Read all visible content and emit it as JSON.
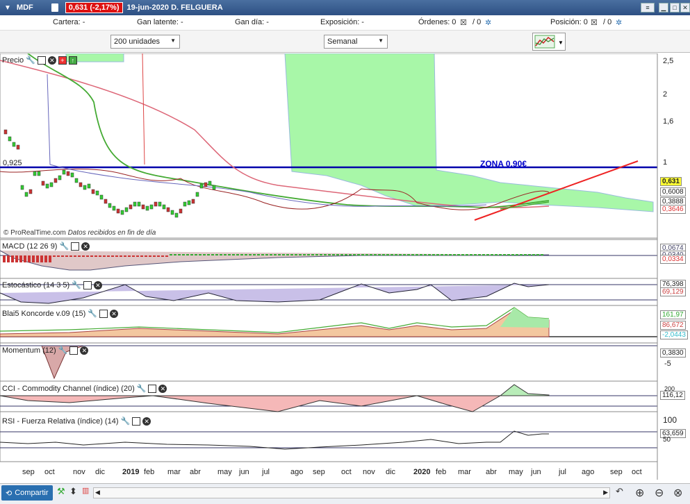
{
  "titlebar": {
    "symbol": "MDF",
    "price_change": "0,631 (-2,17%)",
    "date_name": "19-jun-2020 D. FELGUERA"
  },
  "info": {
    "cartera": "Cartera: -",
    "gan_latente": "Gan latente: -",
    "gan_dia": "Gan día: -",
    "exposicion": "Exposición: -",
    "ordenes": "Órdenes: 0",
    "ordenes_2": "/ 0",
    "posicion": "Posición: 0",
    "posicion_2": "/ 0"
  },
  "controls": {
    "units": "200 unidades",
    "period": "Semanal"
  },
  "panels": {
    "price": {
      "title": "Precio",
      "hline_label": "0,925",
      "zone_label": "ZONA 0,90€",
      "axis": [
        "2,5",
        "2",
        "1,6",
        "1"
      ],
      "tags": [
        {
          "text": "0,631",
          "bg": "#ffff33",
          "color": "#000"
        },
        {
          "text": "0,6008",
          "bg": "#ffffff",
          "color": "#555"
        },
        {
          "text": "0,3888",
          "bg": "#ffffff",
          "color": "#555"
        },
        {
          "text": "0,3646",
          "bg": "#ffffff",
          "color": "#d33"
        }
      ],
      "footer": "© ProRealTime.com",
      "footer_note": "Datos recibidos en fin de día"
    },
    "macd": {
      "title": "MACD (12 26 9)",
      "tags": [
        "0,0674",
        "0,0340",
        "0,0334"
      ]
    },
    "stoch": {
      "title": "Estocástico (14 3 5)",
      "tags": [
        "76,398",
        "69,129"
      ]
    },
    "koncorde": {
      "title": "Blai5 Koncorde v.09 (15)",
      "tags": [
        "161,97",
        "86,672",
        "-2,0443"
      ]
    },
    "momentum": {
      "title": "Momentum (12)",
      "axis": "-5",
      "tags": [
        "0,3830"
      ]
    },
    "cci": {
      "title": "CCI - Commodity Channel (índice) (20)",
      "axis": "200",
      "tags": [
        "116,12"
      ]
    },
    "rsi": {
      "title": "RSI - Fuerza Relativa (índice) (14)",
      "axis_top": "100",
      "axis_mid": "50",
      "tags": [
        "63,659"
      ]
    }
  },
  "xaxis": {
    "labels": [
      "sep",
      "oct",
      "nov",
      "dic",
      "2019",
      "feb",
      "mar",
      "abr",
      "may",
      "jun",
      "jul",
      "ago",
      "sep",
      "oct",
      "nov",
      "dic",
      "2020",
      "feb",
      "mar",
      "abr",
      "may",
      "jun",
      "jul",
      "ago",
      "sep",
      "oct"
    ]
  },
  "bottom": {
    "share": "Compartir"
  },
  "colors": {
    "accent": "#2a6fb0",
    "negative": "#dd1111",
    "zone_line": "#0000aa",
    "trend": "#dd2222",
    "cloud": "#9ef59e"
  }
}
